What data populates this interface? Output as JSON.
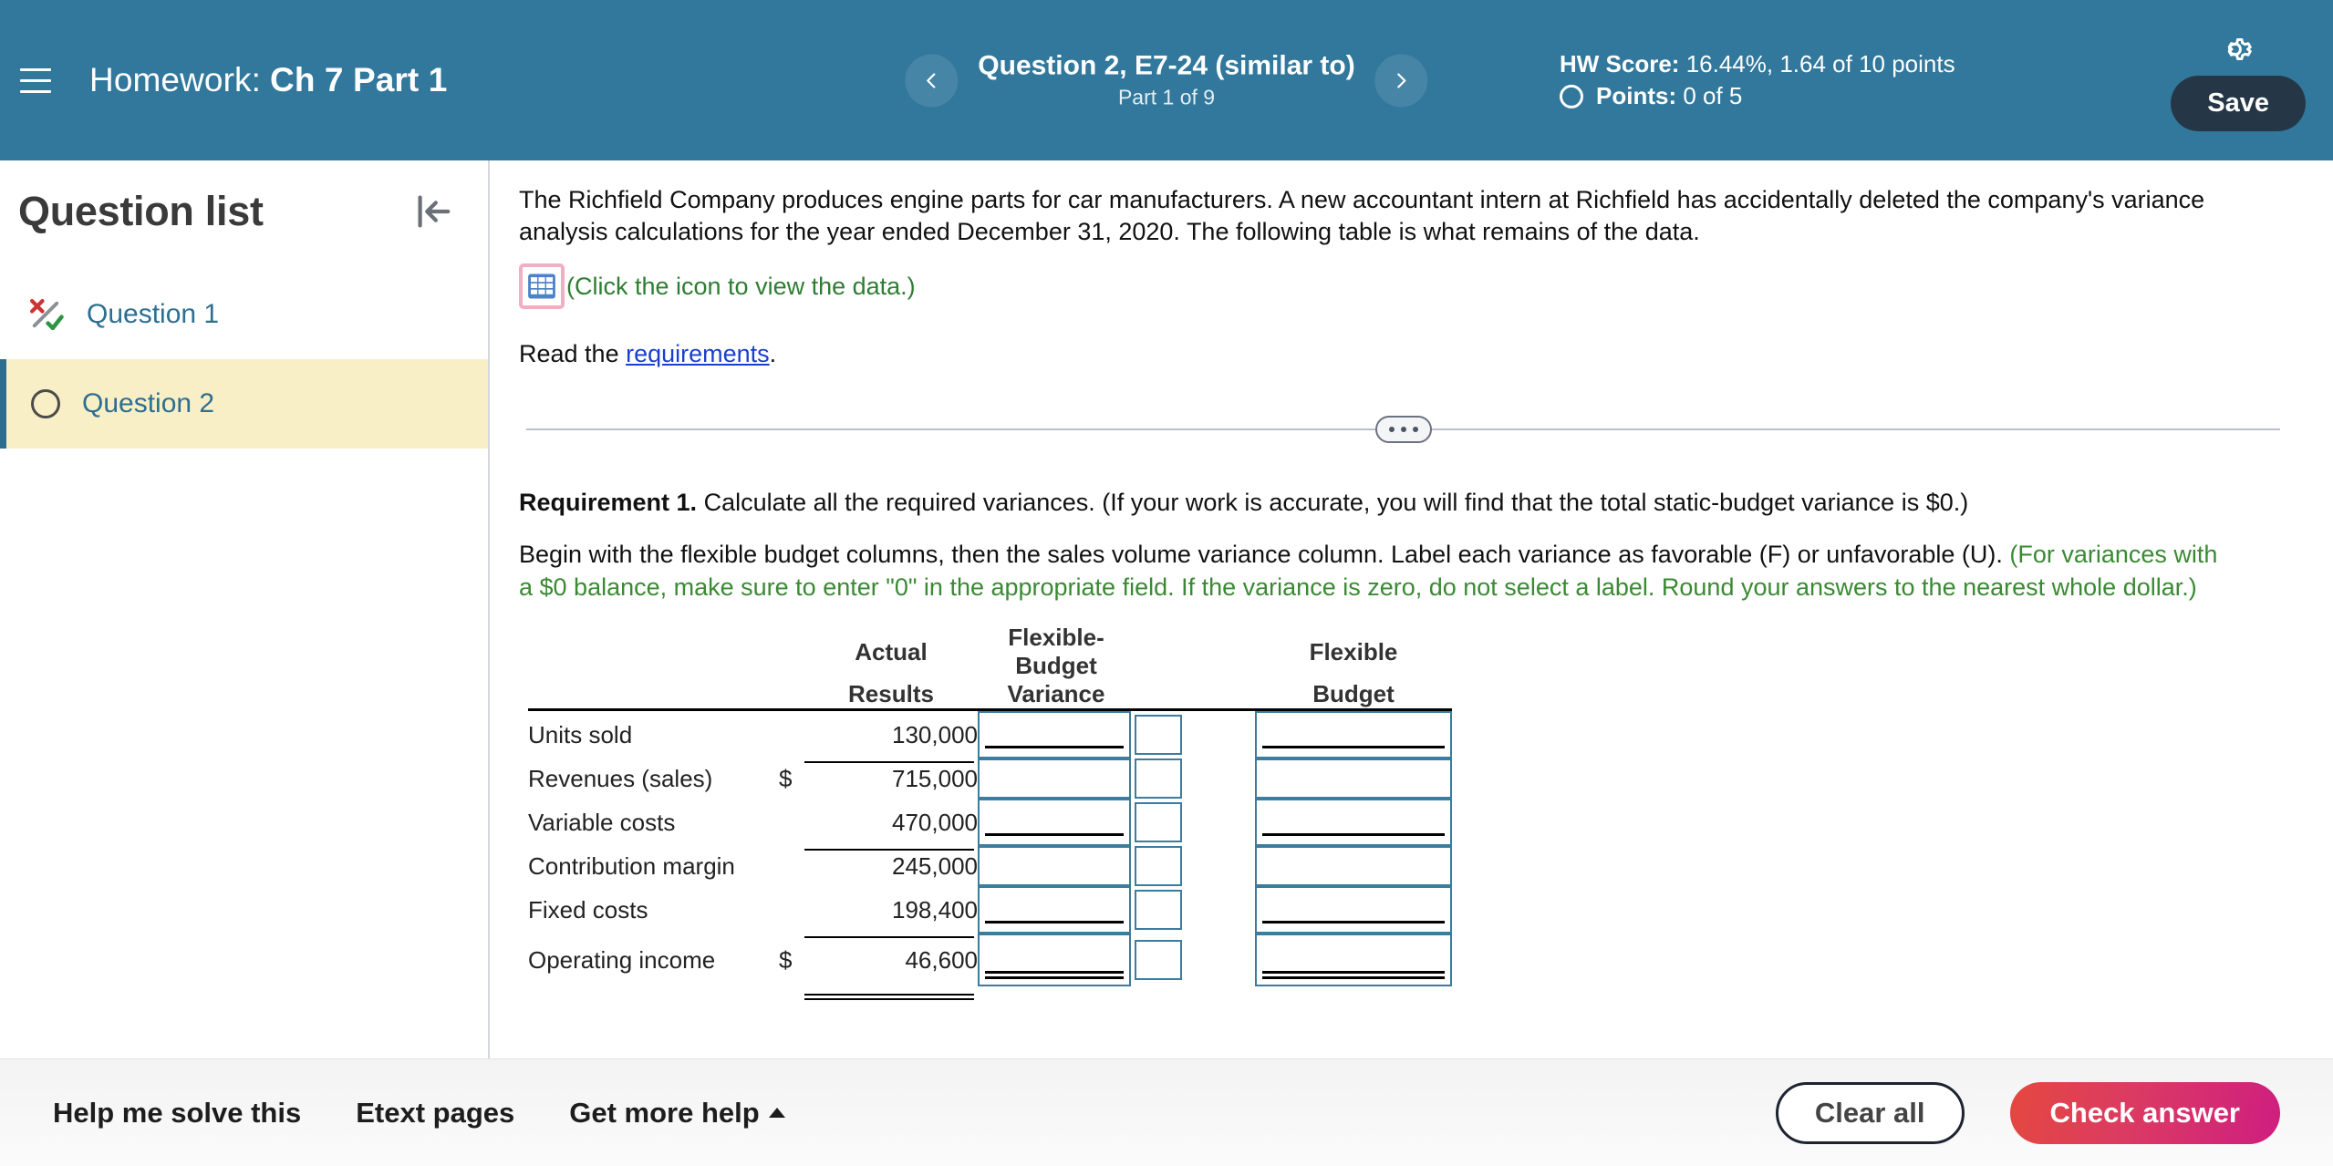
{
  "header": {
    "menu_icon": "hamburger-icon",
    "course_label": "Homework:",
    "assignment_name": "Ch 7 Part 1",
    "prev_icon": "chevron-left-icon",
    "next_icon": "chevron-right-icon",
    "question_title": "Question 2, E7-24 (similar to)",
    "part_label": "Part 1 of 9",
    "hw_score_label": "HW Score:",
    "hw_score_value": "16.44%, 1.64 of 10 points",
    "points_label": "Points:",
    "points_value": "0 of 5",
    "settings_icon": "gear-icon",
    "save_label": "Save"
  },
  "sidebar": {
    "title": "Question list",
    "collapse_icon": "collapse-left-icon",
    "items": [
      {
        "label": "Question 1",
        "status_icon": "partial-credit-icon",
        "active": false
      },
      {
        "label": "Question 2",
        "status_icon": "circle-unanswered-icon",
        "active": true
      }
    ]
  },
  "main": {
    "prompt": "The Richfield Company produces engine parts for car manufacturers. A new accountant intern at Richfield has accidentally deleted the company's variance analysis calculations for the year ended December 31, 2020. The following table is what remains of the data.",
    "data_icon": "table-grid-icon",
    "data_hint": "(Click the icon to view the data.)",
    "read_prefix": "Read the ",
    "read_link": "requirements",
    "read_suffix": ".",
    "divider_icon": "drag-handle-dots-icon",
    "requirement_label": "Requirement 1.",
    "requirement_text": " Calculate all the required variances. (If your work is accurate, you will find that the total static-budget variance is $0.)",
    "instructions_black": "Begin with the flexible budget columns, then the sales volume variance column. Label each variance as favorable (F) or unfavorable (U). ",
    "instructions_green": "(For variances with a $0 balance, make sure to enter \"0\" in the appropriate field. If the variance is zero, do not select a label. Round your answers to the nearest whole dollar.)"
  },
  "answer_table": {
    "headers": [
      {
        "line1": "Actual",
        "line2": "Results"
      },
      {
        "line1": "Flexible-Budget",
        "line2": "Variance"
      },
      {
        "line1": "Flexible",
        "line2": "Budget"
      }
    ],
    "rows": [
      {
        "label": "Units sold",
        "dollar": "",
        "actual": "130,000",
        "underline": "single",
        "variance_value": "",
        "label_value": "",
        "budget_value": ""
      },
      {
        "label": "Revenues (sales)",
        "dollar": "$",
        "actual": "715,000",
        "underline": "none",
        "variance_value": "",
        "label_value": "",
        "budget_value": ""
      },
      {
        "label": "Variable costs",
        "dollar": "",
        "actual": "470,000",
        "underline": "single",
        "variance_value": "",
        "label_value": "",
        "budget_value": ""
      },
      {
        "label": "Contribution margin",
        "dollar": "",
        "actual": "245,000",
        "underline": "none",
        "variance_value": "",
        "label_value": "",
        "budget_value": ""
      },
      {
        "label": "Fixed costs",
        "dollar": "",
        "actual": "198,400",
        "underline": "single",
        "variance_value": "",
        "label_value": "",
        "budget_value": ""
      },
      {
        "label": "Operating income",
        "dollar": "$",
        "actual": "46,600",
        "underline": "double",
        "variance_value": "",
        "label_value": "",
        "budget_value": ""
      }
    ]
  },
  "footer": {
    "help_solve": "Help me solve this",
    "etext_pages": "Etext pages",
    "get_more_help": "Get more help",
    "get_more_help_icon": "caret-up-icon",
    "clear_all": "Clear all",
    "check_answer": "Check answer"
  },
  "colors": {
    "header_teal": "#31789C",
    "save_navy": "#253746",
    "active_yellow": "#F8EFC6",
    "link_blue": "#2C6F91",
    "hint_green": "#2E7D32",
    "input_border": "#3C7C9E",
    "check_gradient_start": "#E4483F",
    "check_gradient_end": "#CE1E80"
  }
}
